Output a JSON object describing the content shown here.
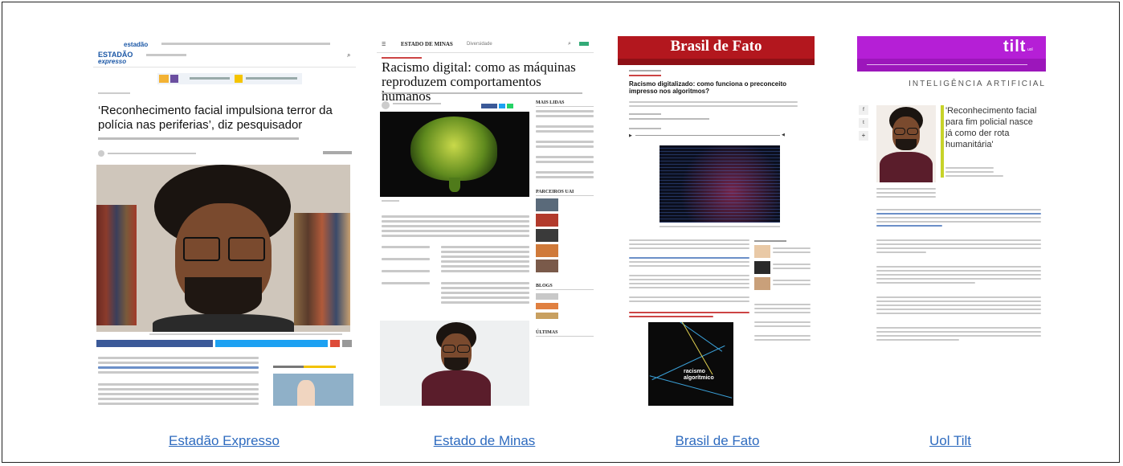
{
  "captions": {
    "estadao": "Estadão Expresso",
    "minas": "Estado de Minas",
    "brasil": "Brasil de Fato",
    "uol": "Uol Tilt"
  },
  "estadao": {
    "logo_top": "estadão",
    "logo_main": "ESTADÃO",
    "logo_sub": "expresso",
    "headline": "‘Reconhecimento facial impulsiona terror da polícia nas periferias’, diz pesquisador"
  },
  "minas": {
    "logo": "ESTADO DE MINAS",
    "section": "Diversidade",
    "headline": "Racismo digital: como as máquinas reproduzem comportamentos humanos",
    "sidebar_title": "MAIS LIDAS",
    "sidebar_title2": "PARCEIROS UAI",
    "sidebar_title3": "BLOGS",
    "sidebar_title4": "ÚLTIMAS"
  },
  "brasil": {
    "logo": "Brasil de Fato",
    "headline": "Racismo digitalizado: como funciona o preconceito impresso nos algoritmos?",
    "book_title": "racismo algorítmico"
  },
  "uol": {
    "logo": "tilt",
    "logo_sub": "uol",
    "section": "INTELIGÊNCIA ARTIFICIAL",
    "headline": "'Reconhecimento facial para fim policial nasce já como der rota humanitária'"
  },
  "colors": {
    "link": "#2e6bbf",
    "brasil_red": "#b3171e",
    "tilt_purple": "#b51fd6",
    "estadao_blue": "#1b57a6"
  }
}
